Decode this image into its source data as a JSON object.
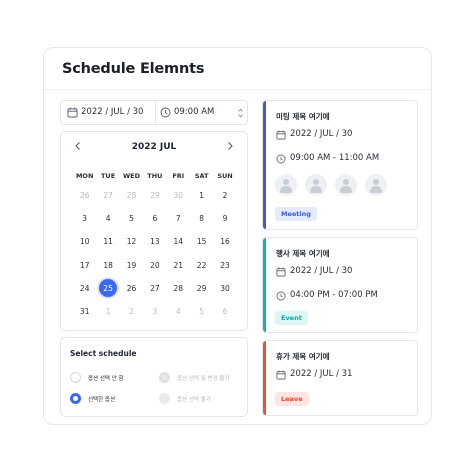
{
  "page": {
    "title": "Schedule Elemnts"
  },
  "picker": {
    "date": "2022 / JUL / 30",
    "time": "09:00 AM"
  },
  "calendar": {
    "month_label": "2022 JUL",
    "prev_icon": "chevron-left-icon",
    "next_icon": "chevron-right-icon",
    "weekdays": [
      "MON",
      "TUE",
      "WED",
      "THU",
      "FRI",
      "SAT",
      "SUN"
    ],
    "days": [
      {
        "d": "26",
        "m": true
      },
      {
        "d": "27",
        "m": true
      },
      {
        "d": "28",
        "m": true
      },
      {
        "d": "29",
        "m": true
      },
      {
        "d": "30",
        "m": true
      },
      {
        "d": "1"
      },
      {
        "d": "2"
      },
      {
        "d": "3"
      },
      {
        "d": "4"
      },
      {
        "d": "5"
      },
      {
        "d": "6"
      },
      {
        "d": "7"
      },
      {
        "d": "8"
      },
      {
        "d": "9"
      },
      {
        "d": "10"
      },
      {
        "d": "11"
      },
      {
        "d": "12"
      },
      {
        "d": "13"
      },
      {
        "d": "14"
      },
      {
        "d": "15"
      },
      {
        "d": "16"
      },
      {
        "d": "17"
      },
      {
        "d": "18"
      },
      {
        "d": "19"
      },
      {
        "d": "20"
      },
      {
        "d": "21"
      },
      {
        "d": "22"
      },
      {
        "d": "23"
      },
      {
        "d": "24"
      },
      {
        "d": "25",
        "sel": true
      },
      {
        "d": "26"
      },
      {
        "d": "27"
      },
      {
        "d": "28"
      },
      {
        "d": "29"
      },
      {
        "d": "30"
      },
      {
        "d": "31"
      },
      {
        "d": "1",
        "m": true
      },
      {
        "d": "2",
        "m": true
      },
      {
        "d": "3",
        "m": true
      },
      {
        "d": "4",
        "m": true
      },
      {
        "d": "5",
        "m": true
      },
      {
        "d": "6",
        "m": true
      }
    ]
  },
  "select_schedule": {
    "title": "Select schedule",
    "options": [
      {
        "label": "옵션 선택 안 함",
        "state": "off"
      },
      {
        "label": "옵션 선택 및 변경 불가",
        "state": "disabled-on"
      },
      {
        "label": "선택한 옵션",
        "state": "on"
      },
      {
        "label": "옵션 선택 불가",
        "state": "disabled"
      }
    ]
  },
  "events": [
    {
      "title": "미팅 제목 여기에",
      "date": "2022 / JUL / 30",
      "time": "09:00 AM - 11:00 AM",
      "badge": "Meeting",
      "accent": "#3b5bdb",
      "badge_bg": "#e3ebfd",
      "badge_fg": "#3b5bdb"
    },
    {
      "title": "행사 제목 여기에",
      "date": "2022 / JUL / 30",
      "time": "04:00 PM - 07:00 PM",
      "badge": "Event",
      "accent": "#12b3ad",
      "badge_bg": "#dcf6f4",
      "badge_fg": "#10a59f"
    },
    {
      "title": "휴가 제목 여기에",
      "date": "2022 / JUL / 31",
      "badge": "Leave",
      "accent": "#f04e36",
      "badge_bg": "#fde6e2",
      "badge_fg": "#e8472f"
    }
  ]
}
